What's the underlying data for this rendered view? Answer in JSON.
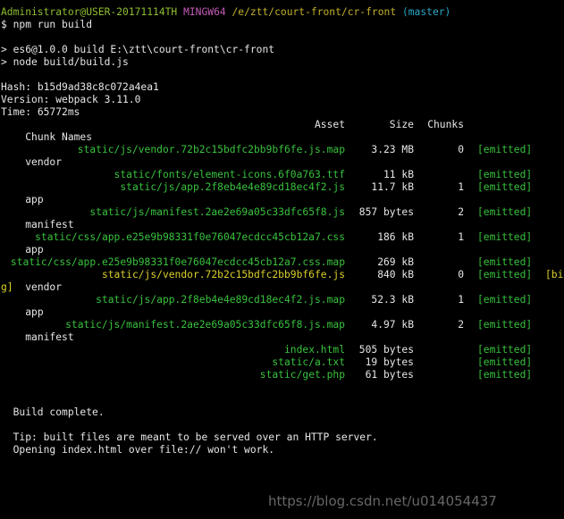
{
  "prompt": {
    "user_host": "Administrator@USER-20171114TH",
    "shell": "MINGW64",
    "path": "/e/ztt/court-front/cr-front",
    "branch": "(master)"
  },
  "command": "$ npm run build",
  "script_lines": [
    "> es6@1.0.0 build E:\\ztt\\court-front\\cr-front",
    "> node build/build.js"
  ],
  "stats": {
    "hash_label": "Hash: ",
    "hash": "b15d9ad38c8c072a4ea1",
    "version_label": "Version: webpack ",
    "version": "3.11.0",
    "time_label": "Time: ",
    "time": "65772ms"
  },
  "table": {
    "headers": {
      "asset": "Asset",
      "size": "Size",
      "chunks": "Chunks",
      "chunk_names": "Chunk Names"
    },
    "rows": [
      {
        "asset": "static/js/vendor.72b2c15bdfc2bb9bf6fe.js.map",
        "size": "3.23 MB",
        "chunks": "0",
        "status": "[emitted]",
        "name": "vendor",
        "big": false
      },
      {
        "asset": "static/fonts/element-icons.6f0a763.ttf",
        "size": "11 kB",
        "chunks": "",
        "status": "[emitted]",
        "name": "",
        "big": false
      },
      {
        "asset": "static/js/app.2f8eb4e4e89cd18ec4f2.js",
        "size": "11.7 kB",
        "chunks": "1",
        "status": "[emitted]",
        "name": "app",
        "big": false
      },
      {
        "asset": "static/js/manifest.2ae2e69a05c33dfc65f8.js",
        "size": "857 bytes",
        "chunks": "2",
        "status": "[emitted]",
        "name": "manifest",
        "big": false
      },
      {
        "asset": "static/css/app.e25e9b98331f0e76047ecdcc45cb12a7.css",
        "size": "186 kB",
        "chunks": "1",
        "status": "[emitted]",
        "name": "app",
        "big": false
      },
      {
        "asset": "static/css/app.e25e9b98331f0e76047ecdcc45cb12a7.css.map",
        "size": "269 kB",
        "chunks": "",
        "status": "[emitted]",
        "name": "",
        "big": false
      },
      {
        "asset": "static/js/vendor.72b2c15bdfc2bb9bf6fe.js",
        "size": "840 kB",
        "chunks": "0",
        "status": "[emitted]",
        "name": "vendor",
        "big": true,
        "big_label_start": "[bi",
        "big_label_end": "g]"
      },
      {
        "asset": "static/js/app.2f8eb4e4e89cd18ec4f2.js.map",
        "size": "52.3 kB",
        "chunks": "1",
        "status": "[emitted]",
        "name": "app",
        "big": false
      },
      {
        "asset": "static/js/manifest.2ae2e69a05c33dfc65f8.js.map",
        "size": "4.97 kB",
        "chunks": "2",
        "status": "[emitted]",
        "name": "manifest",
        "big": false
      },
      {
        "asset": "index.html",
        "size": "505 bytes",
        "chunks": "",
        "status": "[emitted]",
        "name": "",
        "big": false
      },
      {
        "asset": "static/a.txt",
        "size": "19 bytes",
        "chunks": "",
        "status": "[emitted]",
        "name": "",
        "big": false
      },
      {
        "asset": "static/get.php",
        "size": "61 bytes",
        "chunks": "",
        "status": "[emitted]",
        "name": "",
        "big": false
      }
    ]
  },
  "footer": {
    "build_complete": "  Build complete.",
    "tip_1": "  Tip: built files are meant to be served over an HTTP server.",
    "tip_2": "  Opening index.html over file:// won't work."
  },
  "watermark": "https://blog.csdn.net/u014054437",
  "colors": {
    "background": "#000000",
    "text": "#c0c0c0",
    "prompt_user": "#8fbe2f",
    "prompt_shell": "#c45ab7",
    "prompt_path": "#c3b12b",
    "prompt_branch": "#2aa7c6",
    "emitted": "#39c23e",
    "big_asset": "#d8d02a"
  }
}
